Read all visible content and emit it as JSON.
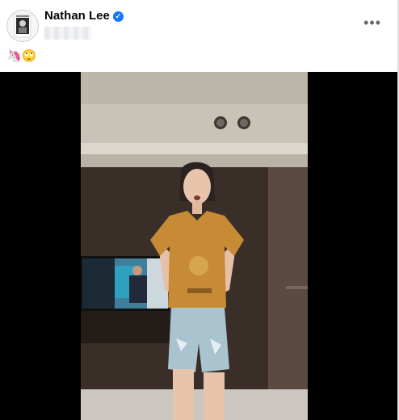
{
  "post": {
    "author": "Nathan Lee",
    "caption_emojis": "🦄🙄"
  },
  "icons": {
    "more": "more-options-icon",
    "verified": "verified-badge-icon"
  },
  "colors": {
    "brand_blue": "#1877f2",
    "letterbox": "#000000",
    "shirt": "#c78a35"
  }
}
